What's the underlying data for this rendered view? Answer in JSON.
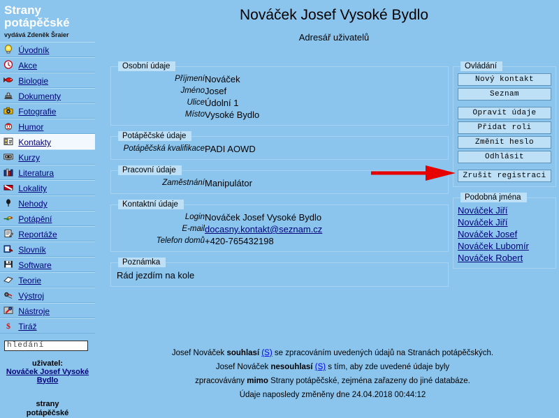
{
  "brand": {
    "line1": "Strany",
    "line2": "potápěčské",
    "publisher": "vydává Zdeněk Šraier"
  },
  "sidebar": {
    "items": [
      {
        "label": "Úvodník",
        "icon": "lightbulb-icon"
      },
      {
        "label": "Akce",
        "icon": "clock-icon"
      },
      {
        "label": "Biologie",
        "icon": "fish-icon"
      },
      {
        "label": "Dokumenty",
        "icon": "stamp-icon"
      },
      {
        "label": "Fotografie",
        "icon": "camera-icon"
      },
      {
        "label": "Humor",
        "icon": "clown-icon"
      },
      {
        "label": "Kontakty",
        "icon": "contact-card-icon",
        "active": true
      },
      {
        "label": "Kurzy",
        "icon": "projector-icon"
      },
      {
        "label": "Literatura",
        "icon": "books-icon"
      },
      {
        "label": "Lokality",
        "icon": "dive-flag-icon"
      },
      {
        "label": "Nehody",
        "icon": "buoy-icon"
      },
      {
        "label": "Potápění",
        "icon": "diver-icon"
      },
      {
        "label": "Reportáže",
        "icon": "notepad-icon"
      },
      {
        "label": "Slovník",
        "icon": "dictionary-icon"
      },
      {
        "label": "Software",
        "icon": "floppy-disk-icon"
      },
      {
        "label": "Teorie",
        "icon": "book-icon"
      },
      {
        "label": "Výstroj",
        "icon": "scuba-gear-icon"
      },
      {
        "label": "Nástroje",
        "icon": "tools-icon"
      },
      {
        "label": "Tiráž",
        "icon": "dollar-sign-icon"
      }
    ],
    "search": {
      "value": "hledání"
    },
    "user": {
      "label": "uživatel:",
      "name": "Nováček Josef Vysoké Bydlo"
    },
    "footer_line1": "strany",
    "footer_line2": "potápěčské"
  },
  "header": {
    "title": "Nováček Josef Vysoké Bydlo",
    "subtitle": "Adresář uživatelů"
  },
  "sections": {
    "personal": {
      "legend": "Osobní údaje",
      "rows": [
        {
          "key": "Příjmení",
          "value": "Nováček"
        },
        {
          "key": "Jméno",
          "value": "Josef"
        },
        {
          "key": "Ulice",
          "value": "Údolní 1"
        },
        {
          "key": "Místo",
          "value": "Vysoké Bydlo"
        }
      ]
    },
    "diving": {
      "legend": "Potápěčské údaje",
      "rows": [
        {
          "key": "Potápěčská kvalifikace",
          "value": "PADI AOWD"
        }
      ]
    },
    "work": {
      "legend": "Pracovní údaje",
      "rows": [
        {
          "key": "Zaměstnání",
          "value": "Manipulátor"
        }
      ]
    },
    "contact": {
      "legend": "Kontaktní údaje",
      "rows": [
        {
          "key": "Login",
          "value": "Nováček Josef Vysoké Bydlo"
        },
        {
          "key": "E-mail",
          "value": "docasny.kontakt@seznam.cz",
          "link": true
        },
        {
          "key": "Telefon domů",
          "value": "+420-765432198"
        }
      ]
    },
    "note": {
      "legend": "Poznámka",
      "text": "Rád jezdím na kole"
    }
  },
  "controls": {
    "legend": "Ovládání",
    "buttons": [
      "Nový kontakt",
      "Seznam",
      "Opravit údaje",
      "Přidat roli",
      "Změnit heslo",
      "Odhlásit",
      "Zrušit registraci"
    ]
  },
  "similar": {
    "legend": "Podobná jména",
    "names": [
      "Nováček Jiří",
      "Nováček Jiří",
      "Nováček Josef",
      "Nováček Lubomír",
      "Nováček Robert"
    ]
  },
  "consent": {
    "line1_a": "Josef Nováček ",
    "line1_b": "souhlasí",
    "line1_sig": "(S)",
    "line1_c": " se zpracováním uvedených údajů na Stranách potápěčských.",
    "line2_a": "Josef Nováček ",
    "line2_b": "nesouhlasí",
    "line2_sig": "(S)",
    "line2_c": " s tím, aby zde uvedené údaje byly",
    "line3_a": "zpracovávány ",
    "line3_b": "mimo",
    "line3_c": " Strany potápěčské, zejména zařazeny do jiné databáze.",
    "timestamp": "Údaje naposledy změněny dne 24.04.2018 00:44:12"
  },
  "annotation": {
    "arrow_color": "#e60000",
    "points_to": "Odhlásit"
  },
  "colors": {
    "page_background": "#8bc5ee",
    "legend_background": "#bde0f7",
    "button_background": "#bde0f7",
    "link": "#00007a",
    "brand_text": "#ffffff"
  }
}
